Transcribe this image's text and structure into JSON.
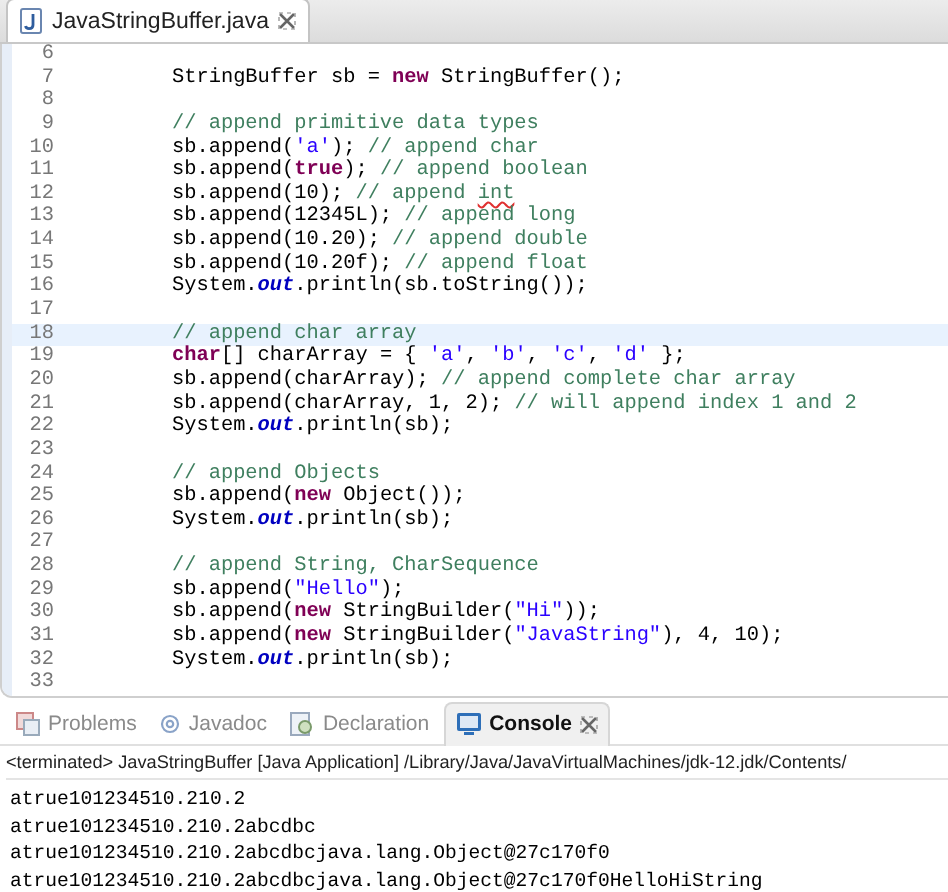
{
  "editor": {
    "tab": {
      "title": "JavaStringBuffer.java",
      "selected": true
    },
    "lines": [
      {
        "number": "6",
        "current": false
      },
      {
        "number": "7",
        "current": false,
        "tokens": [
          {
            "kind": "plain",
            "text": "StringBuffer sb = "
          },
          {
            "kind": "keyword",
            "text": "new"
          },
          {
            "kind": "plain",
            "text": " StringBuffer();"
          }
        ]
      },
      {
        "number": "8",
        "current": false
      },
      {
        "number": "9",
        "current": false,
        "tokens": [
          {
            "kind": "comment",
            "text": "// append primitive data types"
          }
        ]
      },
      {
        "number": "10",
        "current": false,
        "tokens": [
          {
            "kind": "plain",
            "text": "sb.append("
          },
          {
            "kind": "string",
            "text": "'a'"
          },
          {
            "kind": "plain",
            "text": "); "
          },
          {
            "kind": "comment",
            "text": "// append char"
          }
        ]
      },
      {
        "number": "11",
        "current": false,
        "tokens": [
          {
            "kind": "plain",
            "text": "sb.append("
          },
          {
            "kind": "keyword",
            "text": "true"
          },
          {
            "kind": "plain",
            "text": "); "
          },
          {
            "kind": "comment",
            "text": "// append boolean"
          }
        ]
      },
      {
        "number": "12",
        "current": false,
        "tokens": [
          {
            "kind": "plain",
            "text": "sb.append(10); "
          },
          {
            "kind": "comment",
            "text": "// append "
          },
          {
            "kind": "misspelled",
            "text": "int"
          }
        ]
      },
      {
        "number": "13",
        "current": false,
        "tokens": [
          {
            "kind": "plain",
            "text": "sb.append(12345L); "
          },
          {
            "kind": "comment",
            "text": "// append long"
          }
        ]
      },
      {
        "number": "14",
        "current": false,
        "tokens": [
          {
            "kind": "plain",
            "text": "sb.append(10.20); "
          },
          {
            "kind": "comment",
            "text": "// append double"
          }
        ]
      },
      {
        "number": "15",
        "current": false,
        "tokens": [
          {
            "kind": "plain",
            "text": "sb.append(10.20f); "
          },
          {
            "kind": "comment",
            "text": "// append float"
          }
        ]
      },
      {
        "number": "16",
        "current": false,
        "tokens": [
          {
            "kind": "plain",
            "text": "System."
          },
          {
            "kind": "field",
            "text": "out"
          },
          {
            "kind": "plain",
            "text": ".println(sb.toString());"
          }
        ]
      },
      {
        "number": "17",
        "current": false
      },
      {
        "number": "18",
        "current": true,
        "tokens": [
          {
            "kind": "comment",
            "text": "// append char array"
          }
        ]
      },
      {
        "number": "19",
        "current": false,
        "tokens": [
          {
            "kind": "keyword",
            "text": "char"
          },
          {
            "kind": "plain",
            "text": "[] charArray = { "
          },
          {
            "kind": "string",
            "text": "'a'"
          },
          {
            "kind": "plain",
            "text": ", "
          },
          {
            "kind": "string",
            "text": "'b'"
          },
          {
            "kind": "plain",
            "text": ", "
          },
          {
            "kind": "string",
            "text": "'c'"
          },
          {
            "kind": "plain",
            "text": ", "
          },
          {
            "kind": "string",
            "text": "'d'"
          },
          {
            "kind": "plain",
            "text": " };"
          }
        ]
      },
      {
        "number": "20",
        "current": false,
        "tokens": [
          {
            "kind": "plain",
            "text": "sb.append(charArray); "
          },
          {
            "kind": "comment",
            "text": "// append complete char array"
          }
        ]
      },
      {
        "number": "21",
        "current": false,
        "tokens": [
          {
            "kind": "plain",
            "text": "sb.append(charArray, 1, 2); "
          },
          {
            "kind": "comment",
            "text": "// will append index 1 and 2"
          }
        ]
      },
      {
        "number": "22",
        "current": false,
        "tokens": [
          {
            "kind": "plain",
            "text": "System."
          },
          {
            "kind": "field",
            "text": "out"
          },
          {
            "kind": "plain",
            "text": ".println(sb);"
          }
        ]
      },
      {
        "number": "23",
        "current": false
      },
      {
        "number": "24",
        "current": false,
        "tokens": [
          {
            "kind": "comment",
            "text": "// append Objects"
          }
        ]
      },
      {
        "number": "25",
        "current": false,
        "tokens": [
          {
            "kind": "plain",
            "text": "sb.append("
          },
          {
            "kind": "keyword",
            "text": "new"
          },
          {
            "kind": "plain",
            "text": " Object());"
          }
        ]
      },
      {
        "number": "26",
        "current": false,
        "tokens": [
          {
            "kind": "plain",
            "text": "System."
          },
          {
            "kind": "field",
            "text": "out"
          },
          {
            "kind": "plain",
            "text": ".println(sb);"
          }
        ]
      },
      {
        "number": "27",
        "current": false
      },
      {
        "number": "28",
        "current": false,
        "tokens": [
          {
            "kind": "comment",
            "text": "// append String, CharSequence"
          }
        ]
      },
      {
        "number": "29",
        "current": false,
        "tokens": [
          {
            "kind": "plain",
            "text": "sb.append("
          },
          {
            "kind": "string",
            "text": "\"Hello\""
          },
          {
            "kind": "plain",
            "text": ");"
          }
        ]
      },
      {
        "number": "30",
        "current": false,
        "tokens": [
          {
            "kind": "plain",
            "text": "sb.append("
          },
          {
            "kind": "keyword",
            "text": "new"
          },
          {
            "kind": "plain",
            "text": " StringBuilder("
          },
          {
            "kind": "string",
            "text": "\"Hi\""
          },
          {
            "kind": "plain",
            "text": "));"
          }
        ]
      },
      {
        "number": "31",
        "current": false,
        "tokens": [
          {
            "kind": "plain",
            "text": "sb.append("
          },
          {
            "kind": "keyword",
            "text": "new"
          },
          {
            "kind": "plain",
            "text": " StringBuilder("
          },
          {
            "kind": "string",
            "text": "\"JavaString\""
          },
          {
            "kind": "plain",
            "text": "), 4, 10);"
          }
        ]
      },
      {
        "number": "32",
        "current": false,
        "tokens": [
          {
            "kind": "plain",
            "text": "System."
          },
          {
            "kind": "field",
            "text": "out"
          },
          {
            "kind": "plain",
            "text": ".println(sb);"
          }
        ]
      },
      {
        "number": "33",
        "current": false
      }
    ]
  },
  "panel": {
    "tabs": [
      {
        "label": "Problems",
        "kind": "problems",
        "selected": false
      },
      {
        "label": "Javadoc",
        "kind": "javadoc",
        "selected": false
      },
      {
        "label": "Declaration",
        "kind": "declaration",
        "selected": false
      },
      {
        "label": "Console",
        "kind": "console",
        "selected": true
      }
    ],
    "console": {
      "header": "<terminated> JavaStringBuffer [Java Application] /Library/Java/JavaVirtualMachines/jdk-12.jdk/Contents/",
      "output": [
        "atrue101234510.210.2",
        "atrue101234510.210.2abcdbc",
        "atrue101234510.210.2abcdbcjava.lang.Object@27c170f0",
        "atrue101234510.210.2abcdbcjava.lang.Object@27c170f0HelloHiString"
      ]
    }
  }
}
